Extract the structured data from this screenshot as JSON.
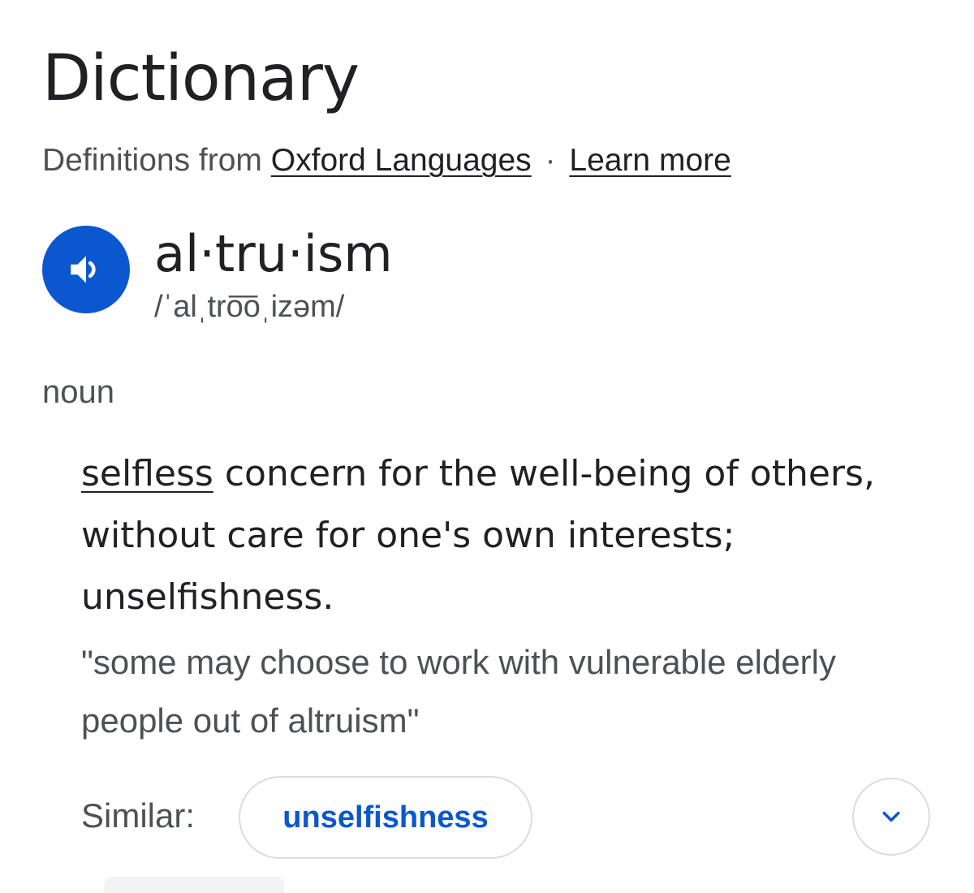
{
  "card": {
    "title": "Dictionary",
    "source_prefix": "Definitions from",
    "source_link": "Oxford Languages",
    "separator": "·",
    "learn_more": "Learn more"
  },
  "entry": {
    "headword": "al·tru·ism",
    "pronunciation": "/ˈalˌtro͞oˌizəm/",
    "speaker_icon": "speaker-icon",
    "part_of_speech": "noun",
    "definition": {
      "link_word": "selfless",
      "text": "concern for the well-being of others, without care for one's own interests; unselfishness."
    },
    "example": "\"some may choose to work with vulnerable elderly people out of altruism\"",
    "similar_label": "Similar:",
    "similar_words": [
      "unselfishness"
    ],
    "expand_icon": "chevron-down-icon"
  },
  "colors": {
    "accent": "#0b57d0",
    "text_primary": "#202124",
    "text_secondary": "#4d5156",
    "border": "#dadce0"
  }
}
